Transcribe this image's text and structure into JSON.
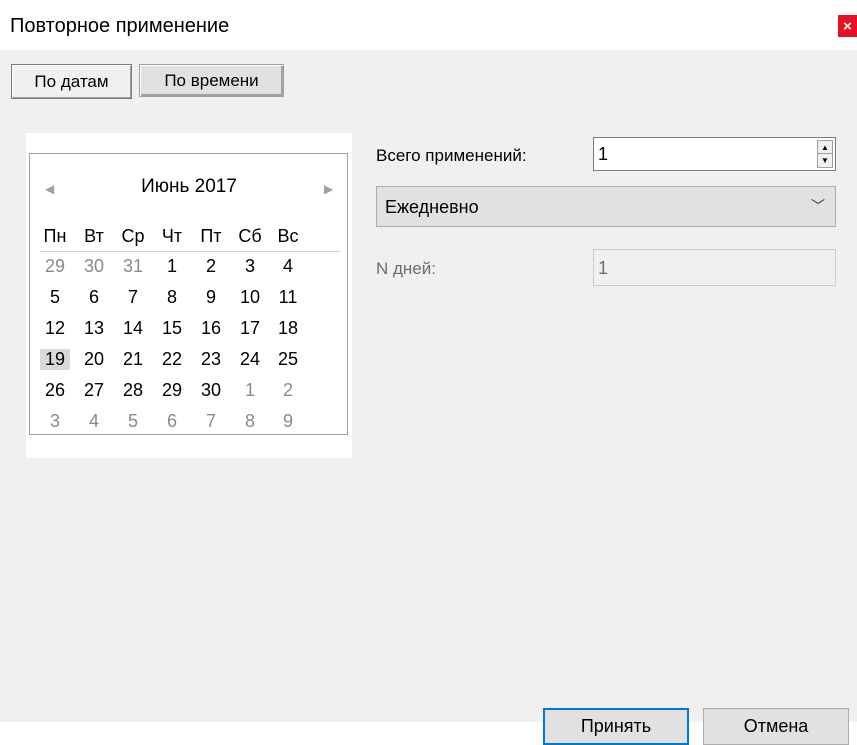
{
  "window": {
    "title": "Повторное применение",
    "close_glyph": "×"
  },
  "tabs": [
    {
      "label": "По датам",
      "active": true
    },
    {
      "label": "По времени",
      "active": false
    }
  ],
  "calendar": {
    "month_title": "Июнь 2017",
    "prev_glyph": "◀",
    "next_glyph": "▶",
    "weekdays": [
      "Пн",
      "Вт",
      "Ср",
      "Чт",
      "Пт",
      "Сб",
      "Вс"
    ],
    "weeks": [
      [
        {
          "d": "29",
          "g": true
        },
        {
          "d": "30",
          "g": true
        },
        {
          "d": "31",
          "g": true
        },
        {
          "d": "1"
        },
        {
          "d": "2"
        },
        {
          "d": "3"
        },
        {
          "d": "4"
        }
      ],
      [
        {
          "d": "5"
        },
        {
          "d": "6"
        },
        {
          "d": "7"
        },
        {
          "d": "8"
        },
        {
          "d": "9"
        },
        {
          "d": "10"
        },
        {
          "d": "11"
        }
      ],
      [
        {
          "d": "12"
        },
        {
          "d": "13"
        },
        {
          "d": "14"
        },
        {
          "d": "15"
        },
        {
          "d": "16"
        },
        {
          "d": "17"
        },
        {
          "d": "18"
        }
      ],
      [
        {
          "d": "19",
          "sel": true
        },
        {
          "d": "20"
        },
        {
          "d": "21"
        },
        {
          "d": "22"
        },
        {
          "d": "23"
        },
        {
          "d": "24"
        },
        {
          "d": "25"
        }
      ],
      [
        {
          "d": "26"
        },
        {
          "d": "27"
        },
        {
          "d": "28"
        },
        {
          "d": "29"
        },
        {
          "d": "30"
        },
        {
          "d": "1",
          "g": true
        },
        {
          "d": "2",
          "g": true
        }
      ],
      [
        {
          "d": "3",
          "g": true
        },
        {
          "d": "4",
          "g": true
        },
        {
          "d": "5",
          "g": true
        },
        {
          "d": "6",
          "g": true
        },
        {
          "d": "7",
          "g": true
        },
        {
          "d": "8",
          "g": true
        },
        {
          "d": "9",
          "g": true
        }
      ]
    ]
  },
  "form": {
    "total_label": "Всего применений:",
    "total_value": "1",
    "frequency_value": "Ежедневно",
    "ndays_label": "N дней:",
    "ndays_value": "1"
  },
  "buttons": {
    "accept_label": "Принять",
    "cancel_label": "Отмена"
  },
  "colors": {
    "close_button": "#e81123",
    "accent_border": "#0078d7",
    "dialog_background": "#f0f0f0"
  }
}
